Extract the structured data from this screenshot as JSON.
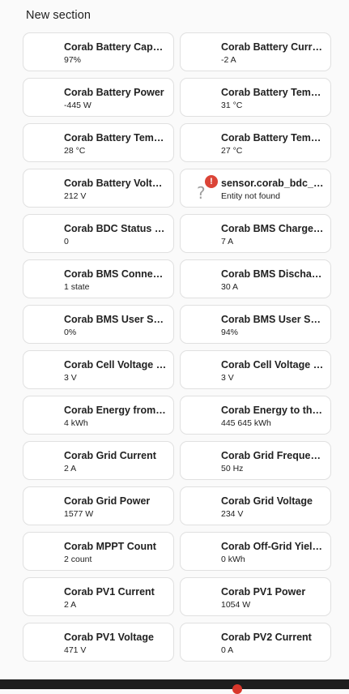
{
  "section": {
    "title": "New section"
  },
  "tiles": [
    {
      "name": "Corab Battery Capacity",
      "state": "97%"
    },
    {
      "name": "Corab Battery Current",
      "state": "-2 A"
    },
    {
      "name": "Corab Battery Power",
      "state": "-445 W"
    },
    {
      "name": "Corab Battery Temperature",
      "state": "31 °C"
    },
    {
      "name": "Corab Battery Temperature",
      "state": "28 °C"
    },
    {
      "name": "Corab Battery Temperature",
      "state": "27 °C"
    },
    {
      "name": "Corab Battery Voltage",
      "state": "212 V"
    },
    {
      "name": "sensor.corab_bdc_status",
      "state": "Entity not found",
      "warning": true,
      "warning_icon": "question-mark-icon",
      "badge_icon": "alert-badge-icon",
      "badge_symbol": "!",
      "question_symbol": "?"
    },
    {
      "name": "Corab BDC Status Register",
      "state": "0"
    },
    {
      "name": "Corab BMS Charge Current",
      "state": "7 A"
    },
    {
      "name": "Corab BMS Connect State",
      "state": "1 state"
    },
    {
      "name": "Corab BMS Discharge Current",
      "state": "30 A"
    },
    {
      "name": "Corab BMS User SOC",
      "state": "0%"
    },
    {
      "name": "Corab BMS User SOH",
      "state": "94%"
    },
    {
      "name": "Corab Cell Voltage Highest",
      "state": "3 V"
    },
    {
      "name": "Corab Cell Voltage Lowest",
      "state": "3 V"
    },
    {
      "name": "Corab Energy from the grid",
      "state": "4 kWh"
    },
    {
      "name": "Corab Energy to the grid",
      "state": "445 645 kWh"
    },
    {
      "name": "Corab Grid Current",
      "state": "2 A"
    },
    {
      "name": "Corab Grid Frequency",
      "state": "50 Hz"
    },
    {
      "name": "Corab Grid Power",
      "state": "1577 W"
    },
    {
      "name": "Corab Grid Voltage",
      "state": "234 V"
    },
    {
      "name": "Corab MPPT Count",
      "state": "2 count"
    },
    {
      "name": "Corab Off-Grid Yield Total",
      "state": "0 kWh"
    },
    {
      "name": "Corab PV1 Current",
      "state": "2 A"
    },
    {
      "name": "Corab PV1 Power",
      "state": "1054 W"
    },
    {
      "name": "Corab PV1 Voltage",
      "state": "471 V"
    },
    {
      "name": "Corab PV2 Current",
      "state": "0 A"
    }
  ],
  "colors": {
    "background": "#fafafa",
    "tile_border": "#e0e0e0",
    "error_badge": "#db4437",
    "bottom_bar": "#1e1e1e"
  }
}
